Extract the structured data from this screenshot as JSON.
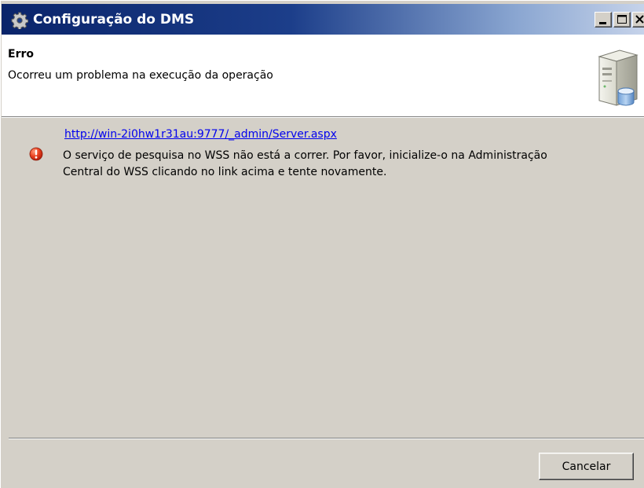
{
  "window": {
    "title": "Configuração do DMS",
    "title_icon": "gear-icon",
    "buttons": {
      "minimize_icon": "minimize-icon",
      "maximize_icon": "maximize-icon",
      "close_icon": "close-icon"
    }
  },
  "header": {
    "title": "Erro",
    "message": "Ocorreu um problema na execução da operação",
    "graphic_icon": "server-database-icon"
  },
  "content": {
    "link": "http://win-2i0hw1r31au:9777/_admin/Server.aspx",
    "status_icon": "error-icon",
    "message": "O serviço de pesquisa no WSS não está a correr. Por favor, inicialize-o na Administração Central do WSS clicando no link acima e tente novamente."
  },
  "footer": {
    "cancel_label": "Cancelar"
  },
  "colors": {
    "titlebar_start": "#0a246a",
    "titlebar_end": "#c6d3ea",
    "dialog_bg": "#d4d0c8",
    "link": "#0000ee",
    "error": "#d0281c"
  }
}
